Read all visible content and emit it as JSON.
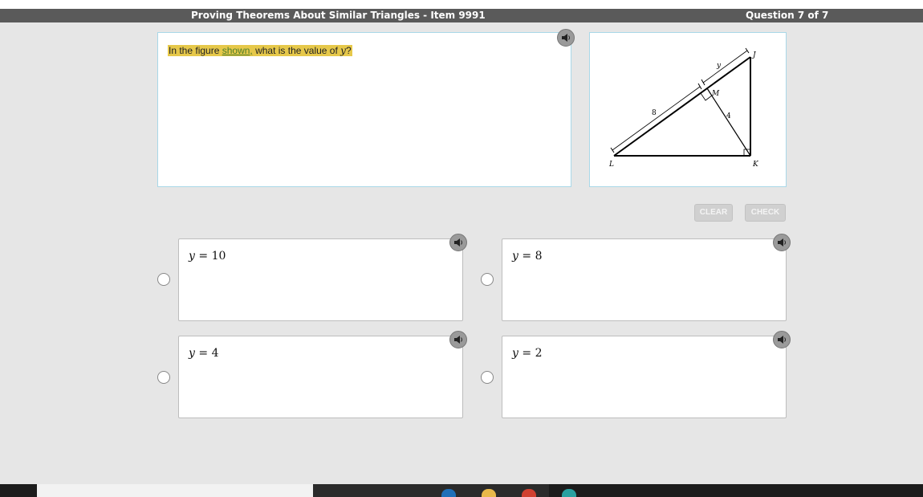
{
  "header": {
    "title": "Proving Theorems About Similar Triangles - Item 9991",
    "question_counter": "Question 7 of 7"
  },
  "question": {
    "prefix": "In the figure ",
    "link": "shown,",
    "middle": " what is the value of ",
    "variable": "y",
    "suffix": "?"
  },
  "figure": {
    "labels": {
      "J": "J",
      "K": "K",
      "L": "L",
      "M": "M",
      "y": "y",
      "eight": "8",
      "four": "4"
    }
  },
  "buttons": {
    "clear": "CLEAR",
    "check": "CHECK"
  },
  "answers": [
    {
      "var": "y",
      "eq": " = ",
      "value": "10"
    },
    {
      "var": "y",
      "eq": " = ",
      "value": "8"
    },
    {
      "var": "y",
      "eq": " = ",
      "value": "4"
    },
    {
      "var": "y",
      "eq": " = ",
      "value": "2"
    }
  ],
  "icons": {
    "speaker": "speaker-icon",
    "radio": "radio-button"
  },
  "colors": {
    "highlight": "#e6c84a",
    "title_bar": "#5a5a5a",
    "panel_border": "#a9d8e8"
  }
}
